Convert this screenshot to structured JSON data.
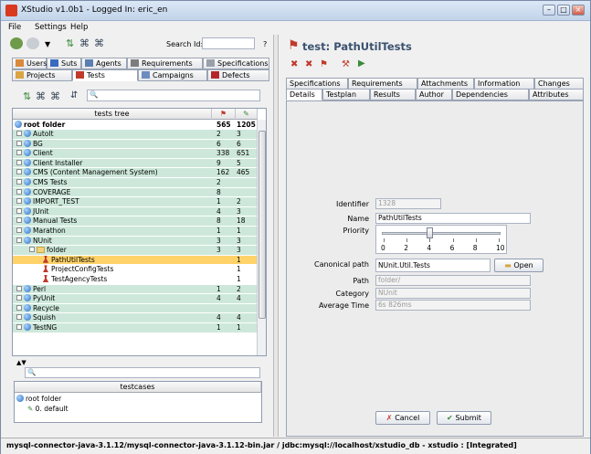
{
  "window": {
    "title": "XStudio v1.0b1 - Logged In: eric_en"
  },
  "menu": [
    "File",
    "Settings",
    "Help"
  ],
  "toolbar": {
    "search_label": "Search Id:",
    "search_value": "",
    "help_label": "?"
  },
  "nav_tabs_row1": [
    "Users",
    "Suts",
    "Agents",
    "Requirements",
    "Specifications"
  ],
  "nav_tabs_row2": [
    "Projects",
    "Tests",
    "Campaigns",
    "Defects"
  ],
  "tree": {
    "header": "tests tree",
    "root": {
      "label": "root folder",
      "c1": "565",
      "c2": "1205"
    },
    "rows": [
      {
        "label": "AutoIt",
        "c1": "2",
        "c2": "3",
        "type": "globe",
        "style": "green",
        "indent": 0
      },
      {
        "label": "BG",
        "c1": "6",
        "c2": "6",
        "type": "globe",
        "style": "green",
        "indent": 0
      },
      {
        "label": "Client",
        "c1": "338",
        "c2": "651",
        "type": "globe",
        "style": "green",
        "indent": 0
      },
      {
        "label": "Client Installer",
        "c1": "9",
        "c2": "5",
        "type": "globe",
        "style": "green",
        "indent": 0
      },
      {
        "label": "CMS (Content Management System)",
        "c1": "162",
        "c2": "465",
        "type": "globe",
        "style": "green",
        "indent": 0
      },
      {
        "label": "CMS Tests",
        "c1": "2",
        "c2": "",
        "type": "globe",
        "style": "green",
        "indent": 0
      },
      {
        "label": "COVERAGE",
        "c1": "8",
        "c2": "",
        "type": "globe",
        "style": "green",
        "indent": 0
      },
      {
        "label": "IMPORT_TEST",
        "c1": "1",
        "c2": "2",
        "type": "globe",
        "style": "green",
        "indent": 0
      },
      {
        "label": "JUnit",
        "c1": "4",
        "c2": "3",
        "type": "globe",
        "style": "green",
        "indent": 0
      },
      {
        "label": "Manual Tests",
        "c1": "8",
        "c2": "18",
        "type": "globe",
        "style": "green",
        "indent": 0
      },
      {
        "label": "Marathon",
        "c1": "1",
        "c2": "1",
        "type": "globe",
        "style": "green",
        "indent": 0
      },
      {
        "label": "NUnit",
        "c1": "3",
        "c2": "3",
        "type": "globe",
        "style": "green",
        "indent": 0
      },
      {
        "label": "folder",
        "c1": "3",
        "c2": "3",
        "type": "folder",
        "style": "green",
        "indent": 1
      },
      {
        "label": "PathUtilTests",
        "c1": "",
        "c2": "1",
        "type": "test",
        "style": "sel",
        "indent": 2
      },
      {
        "label": "ProjectConfigTests",
        "c1": "",
        "c2": "1",
        "type": "test",
        "style": "white",
        "indent": 2
      },
      {
        "label": "TestAgencyTests",
        "c1": "",
        "c2": "1",
        "type": "test",
        "style": "white",
        "indent": 2
      },
      {
        "label": "Perl",
        "c1": "1",
        "c2": "2",
        "type": "globe",
        "style": "green",
        "indent": 0
      },
      {
        "label": "PyUnit",
        "c1": "4",
        "c2": "4",
        "type": "globe",
        "style": "green",
        "indent": 0
      },
      {
        "label": "Recycle",
        "c1": "",
        "c2": "",
        "type": "globe",
        "style": "green",
        "indent": 0
      },
      {
        "label": "Squish",
        "c1": "4",
        "c2": "4",
        "type": "globe",
        "style": "green",
        "indent": 0
      },
      {
        "label": "TestNG",
        "c1": "1",
        "c2": "1",
        "type": "globe",
        "style": "green",
        "indent": 0
      }
    ]
  },
  "testcases": {
    "header": "testcases",
    "root": "root folder",
    "item": "0. default"
  },
  "detail": {
    "title": "test: PathUtilTests",
    "tabs_row1": [
      "Specifications",
      "Requirements",
      "Attachments",
      "Information",
      "Changes"
    ],
    "tabs_row2": [
      "Details",
      "Testplan",
      "Results",
      "Author",
      "Dependencies",
      "Attributes"
    ],
    "fields": {
      "identifier_label": "Identifier",
      "identifier_value": "1328",
      "name_label": "Name",
      "name_value": "PathUtilTests",
      "priority_label": "Priority",
      "priority_ticks": [
        "0",
        "2",
        "4",
        "6",
        "8",
        "10"
      ],
      "priority_value": 4,
      "canonical_label": "Canonical path",
      "canonical_value": "NUnit.Util.Tests",
      "open_label": "Open",
      "path_label": "Path",
      "path_value": "folder/",
      "category_label": "Category",
      "category_value": "NUnit",
      "avgtime_label": "Average Time",
      "avgtime_value": "6s 826ms"
    },
    "cancel_label": "Cancel",
    "submit_label": "Submit"
  },
  "statusbar": "mysql-connector-java-3.1.12/mysql-connector-java-3.1.12-bin.jar / jdbc:mysql://localhost/xstudio_db - xstudio : [Integrated]"
}
